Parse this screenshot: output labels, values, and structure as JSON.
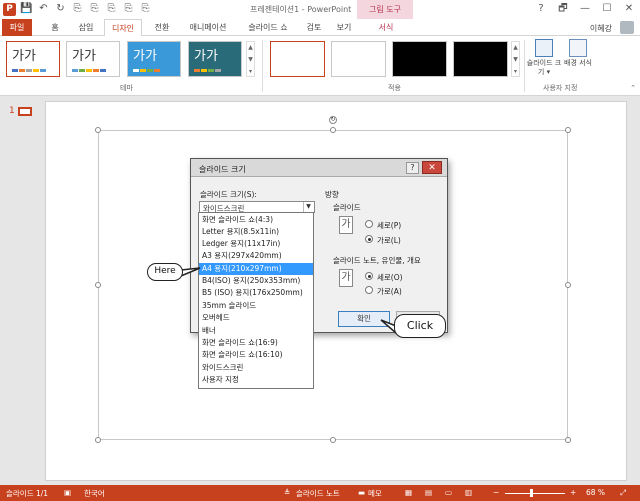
{
  "window": {
    "title": "프레젠테이션1 - PowerPoint",
    "context_tab_group": "그림 도구",
    "user": "이혜강",
    "controls": [
      "?",
      "🗗",
      "—",
      "☐",
      "✕"
    ]
  },
  "qat": [
    "💾",
    "↶",
    "↻",
    "⎘",
    "⎘",
    "⎘",
    "⎘",
    "⎘"
  ],
  "tabs": [
    "파일",
    "홈",
    "삽입",
    "디자인",
    "전환",
    "애니메이션",
    "슬라이드 쇼",
    "검토",
    "보기",
    "서식"
  ],
  "active_tab": "디자인",
  "ribbon": {
    "themes_label": "테마",
    "variants_label": "적용",
    "customize_label": "사용자 지정",
    "theme_text": "가가",
    "slide_size_btn": "슬라이드 크기",
    "background_btn": "배경 서식",
    "theme_colors": [
      "#ffffff",
      "#ffffff",
      "#3a9ad9",
      "#2a6b7a"
    ],
    "variant_colors": [
      "#ffffff",
      "#ffffff",
      "#000000",
      "#000000"
    ]
  },
  "slides_pane": {
    "slide_number": "1"
  },
  "dialog": {
    "title": "슬라이드 크기",
    "help": "?",
    "close": "✕",
    "size_label": "슬라이드 크기(S):",
    "size_value": "와이드스크린",
    "orientation_label": "방향",
    "slides_label": "슬라이드",
    "portrait": "세로(P)",
    "landscape": "가로(L)",
    "notes_label": "슬라이드 노트, 유인물, 개요",
    "notes_portrait": "세로(O)",
    "notes_landscape": "가로(A)",
    "ok": "확인"
  },
  "dropdown_options": [
    "화면 슬라이드 쇼(4:3)",
    "Letter 용지(8.5x11in)",
    "Ledger 용지(11x17in)",
    "A3 용지(297x420mm)",
    "A4 용지(210x297mm)",
    "B4(ISO) 용지(250x353mm)",
    "B5 (ISO) 용지(176x250mm)",
    "35mm 슬라이드",
    "오버헤드",
    "배너",
    "화면 슬라이드 쇼(16:9)",
    "화면 슬라이드 쇼(16:10)",
    "와이드스크린",
    "사용자 지정"
  ],
  "selected_option": "A4 용지(210x297mm)",
  "annotations": {
    "here": "Here",
    "click": "Click"
  },
  "status": {
    "slide": "슬라이드 1/1",
    "language": "한국어",
    "notes": "슬라이드 노트",
    "comments": "메모",
    "zoom": "68 %"
  },
  "colors": {
    "accent": "#c7411f",
    "selection": "#3399ff"
  }
}
